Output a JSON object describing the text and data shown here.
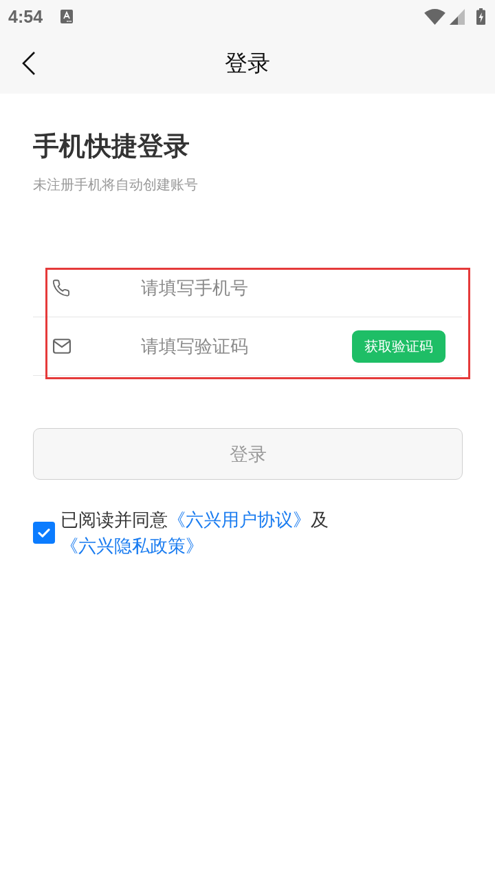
{
  "status_bar": {
    "time": "4:54"
  },
  "header": {
    "title": "登录"
  },
  "intro": {
    "title": "手机快捷登录",
    "subtitle": "未注册手机将自动创建账号"
  },
  "form": {
    "highlighted": true,
    "fields": [
      {
        "kind": "phone",
        "placeholder": "请填写手机号"
      },
      {
        "kind": "code",
        "placeholder": "请填写验证码",
        "button": "获取验证码"
      }
    ]
  },
  "login_button": {
    "label": "登录",
    "disabled": true
  },
  "agreement": {
    "checked": true,
    "parts": [
      {
        "kind": "text",
        "text": "已阅读并同意"
      },
      {
        "kind": "link",
        "text": "《六兴用户协议》"
      },
      {
        "kind": "text",
        "text": "及"
      },
      {
        "kind": "link",
        "text": "《六兴隐私政策》"
      }
    ]
  }
}
